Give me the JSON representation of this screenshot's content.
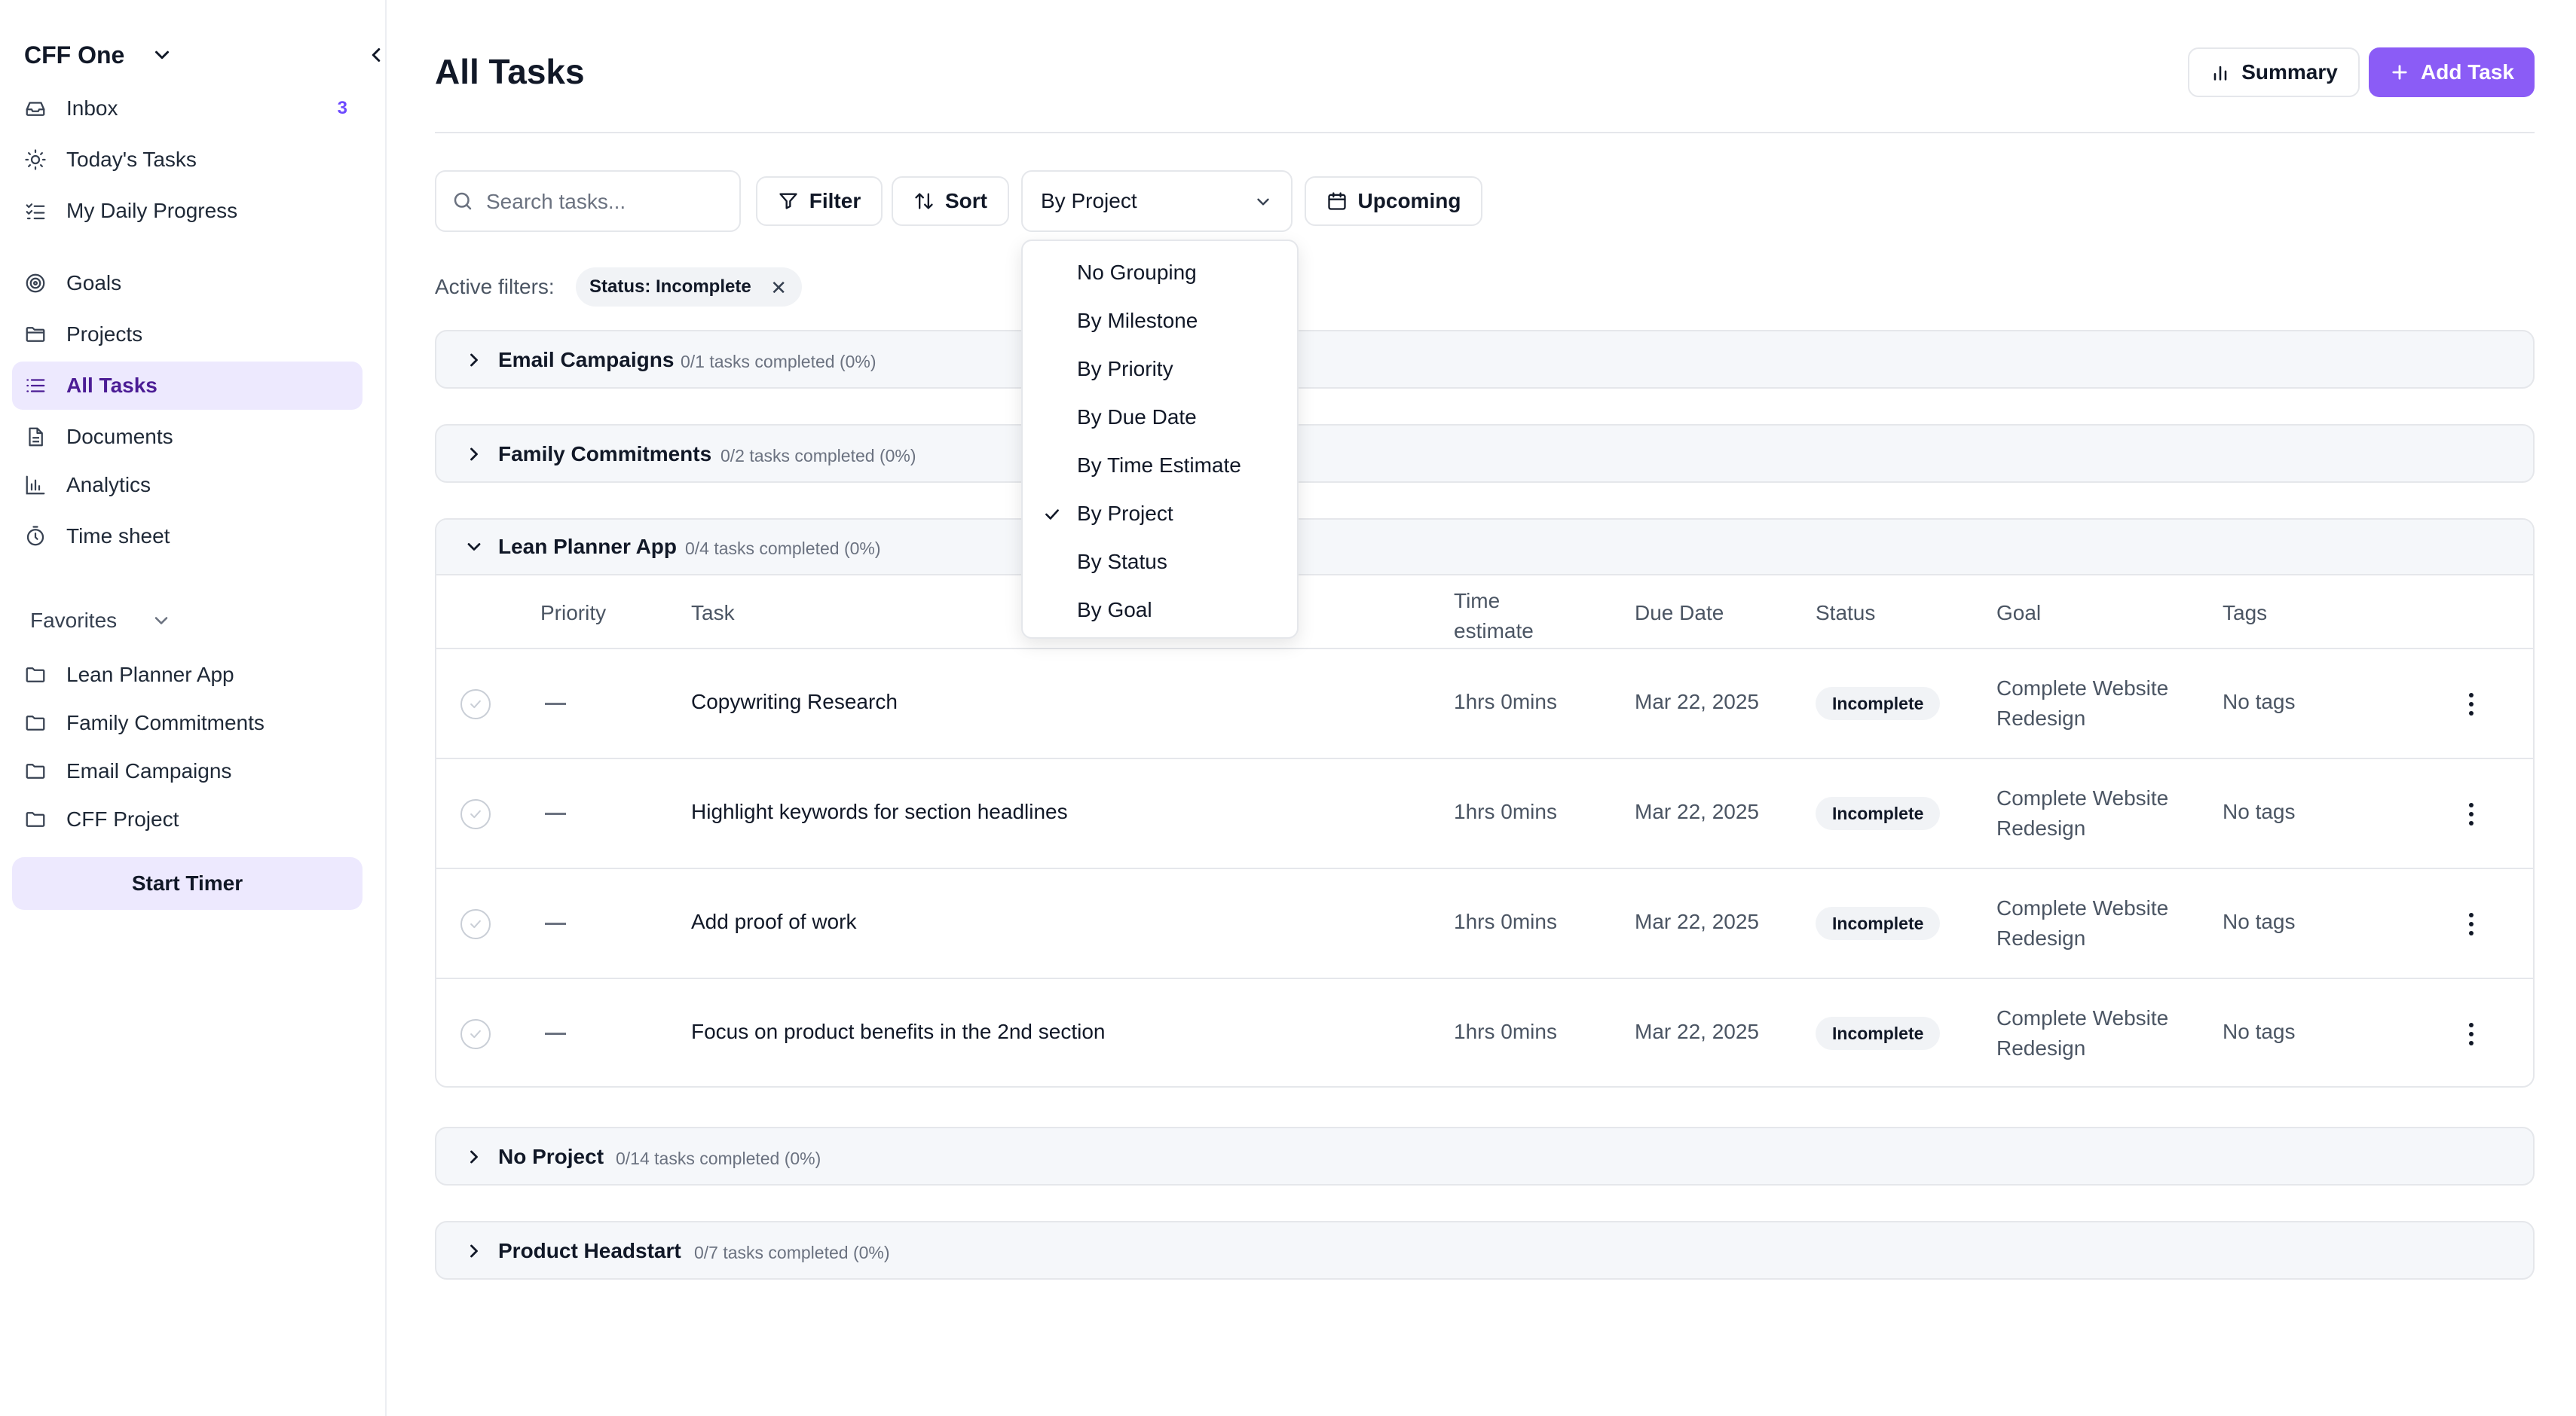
{
  "sidebar": {
    "workspace": "CFF One",
    "nav": [
      {
        "label": "Inbox",
        "badge": "3",
        "icon": "inbox-icon"
      },
      {
        "label": "Today's Tasks",
        "icon": "sun-icon"
      },
      {
        "label": "My Daily Progress",
        "icon": "checklist-icon"
      },
      {
        "label": "Goals",
        "icon": "target-icon"
      },
      {
        "label": "Projects",
        "icon": "folder-icon"
      },
      {
        "label": "All Tasks",
        "icon": "list-icon",
        "active": true
      },
      {
        "label": "Documents",
        "icon": "document-icon"
      },
      {
        "label": "Analytics",
        "icon": "bar-chart-icon"
      },
      {
        "label": "Time sheet",
        "icon": "stopwatch-icon"
      }
    ],
    "favorites_title": "Favorites",
    "favorites": [
      "Lean Planner App",
      "Family Commitments",
      "Email Campaigns",
      "CFF Project"
    ],
    "start_timer": "Start Timer"
  },
  "header": {
    "title": "All Tasks",
    "summary_label": "Summary",
    "add_task_label": "Add Task"
  },
  "toolbar": {
    "search_placeholder": "Search tasks...",
    "filter_label": "Filter",
    "sort_label": "Sort",
    "grouping_selected": "By Project",
    "upcoming_label": "Upcoming"
  },
  "filters": {
    "label": "Active filters:",
    "chips": [
      "Status: Incomplete"
    ]
  },
  "grouping_menu": {
    "options": [
      "No Grouping",
      "By Milestone",
      "By Priority",
      "By Due Date",
      "By Time Estimate",
      "By Project",
      "By Status",
      "By Goal"
    ],
    "selected": "By Project"
  },
  "groups": [
    {
      "name": "Email Campaigns",
      "meta": "0/1 tasks completed (0%)",
      "expanded": false
    },
    {
      "name": "Family Commitments",
      "meta": "0/2 tasks completed (0%)",
      "expanded": false
    },
    {
      "name": "Lean Planner App",
      "meta": "0/4 tasks completed (0%)",
      "expanded": true
    },
    {
      "name": "No Project",
      "meta": "0/14 tasks completed (0%)",
      "expanded": false
    },
    {
      "name": "Product Headstart",
      "meta": "0/7 tasks completed (0%)",
      "expanded": false
    }
  ],
  "table": {
    "columns": {
      "priority": "Priority",
      "task": "Task",
      "time_estimate": "Time estimate",
      "due_date": "Due Date",
      "status": "Status",
      "goal": "Goal",
      "tags": "Tags"
    },
    "rows": [
      {
        "priority": "—",
        "task": "Copywriting Research",
        "time": "1hrs 0mins",
        "due": "Mar 22, 2025",
        "status": "Incomplete",
        "goal": "Complete Website Redesign",
        "tags": "No tags"
      },
      {
        "priority": "—",
        "task": "Highlight keywords for section headlines",
        "time": "1hrs 0mins",
        "due": "Mar 22, 2025",
        "status": "Incomplete",
        "goal": "Complete Website Redesign",
        "tags": "No tags"
      },
      {
        "priority": "—",
        "task": "Add proof of work",
        "time": "1hrs 0mins",
        "due": "Mar 22, 2025",
        "status": "Incomplete",
        "goal": "Complete Website Redesign",
        "tags": "No tags"
      },
      {
        "priority": "—",
        "task": "Focus on product benefits in the 2nd section",
        "time": "1hrs 0mins",
        "due": "Mar 22, 2025",
        "status": "Incomplete",
        "goal": "Complete Website Redesign",
        "tags": "No tags"
      }
    ]
  },
  "colors": {
    "accent": "#8b5cf6",
    "active_bg": "#ede9fe",
    "badge": "#6d4aff"
  }
}
